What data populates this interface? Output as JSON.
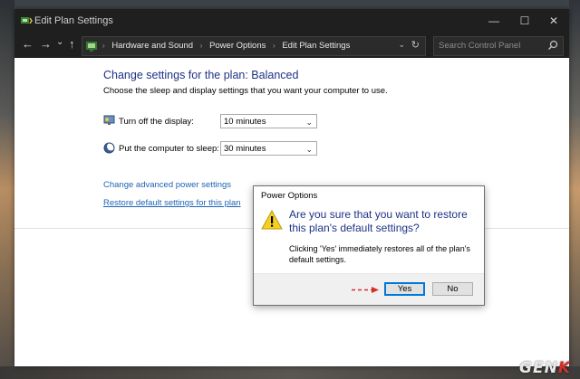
{
  "window": {
    "title": "Edit Plan Settings",
    "controls": {
      "minimize": "—",
      "maximize": "☐",
      "close": "✕"
    }
  },
  "nav": {
    "back": "←",
    "forward": "→",
    "recent": "⌄",
    "up": "↑",
    "breadcrumb": [
      "Hardware and Sound",
      "Power Options",
      "Edit Plan Settings"
    ],
    "breadcrumb_sep": "›",
    "search_placeholder": "Search Control Panel"
  },
  "main": {
    "heading": "Change settings for the plan: Balanced",
    "subheading": "Choose the sleep and display settings that you want your computer to use.",
    "settings": [
      {
        "label": "Turn off the display:",
        "value": "10 minutes",
        "icon": "monitor-icon"
      },
      {
        "label": "Put the computer to sleep:",
        "value": "30 minutes",
        "icon": "moon-icon"
      }
    ],
    "links": {
      "advanced": "Change advanced power settings",
      "restore": "Restore default settings for this plan"
    }
  },
  "dialog": {
    "title": "Power Options",
    "question": "Are you sure that you want to restore this plan's default settings?",
    "detail": "Clicking 'Yes' immediately restores all of the plan's default settings.",
    "yes_label": "Yes",
    "no_label": "No",
    "icon": "warning-icon"
  },
  "watermark": {
    "prefix": "GEN",
    "suffix": "K"
  },
  "colors": {
    "heading_blue": "#1e3287",
    "link_blue": "#1e64b4",
    "annotation_red": "#d2302c"
  }
}
